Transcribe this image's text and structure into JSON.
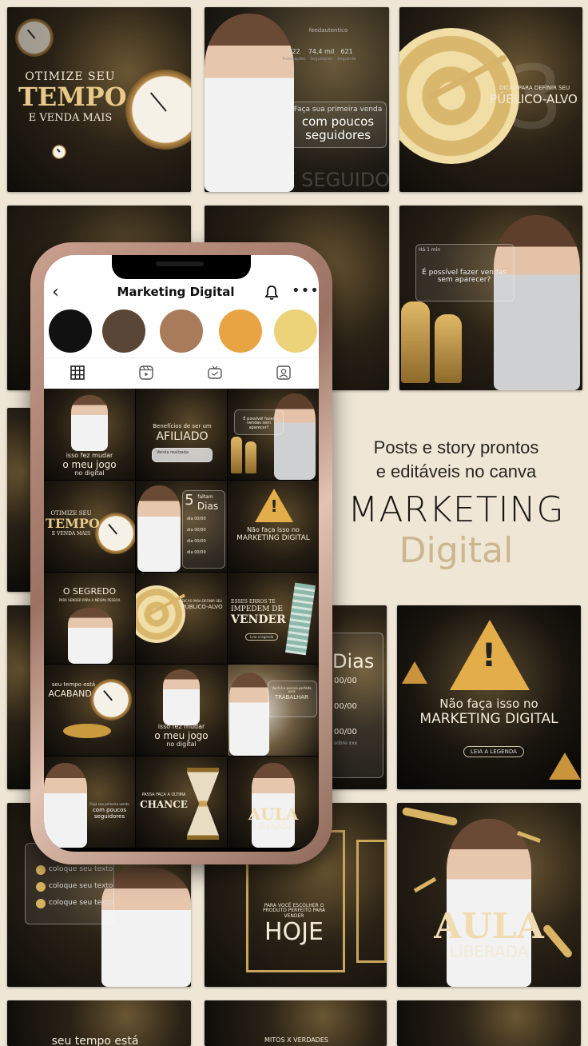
{
  "app": {
    "profile_title": "Marketing Digital",
    "back_icon": "chevron-left-icon",
    "bell_icon": "bell-icon",
    "more_icon": "more-horizontal-icon"
  },
  "palette": [
    "#111111",
    "#5a4636",
    "#a87b5a",
    "#e8a443",
    "#ecd279"
  ],
  "tabs": [
    "grid-icon",
    "reels-icon",
    "tv-icon",
    "tagged-icon"
  ],
  "promo": {
    "line1": "Posts e story prontos",
    "line2": "e editáveis no canva",
    "title_top": "MARKETING",
    "title_bottom": "Digital"
  },
  "tiles": {
    "otimize": {
      "top": "OTIMIZE SEU",
      "big": "TEMPO",
      "bottom": "E VENDA MAIS"
    },
    "seguidores": {
      "handle": "feedautentico",
      "stats": [
        "322",
        "74,4 mil",
        "621"
      ],
      "stat_labels": [
        "Publicações",
        "Seguidores",
        "Seguindo"
      ],
      "line1": "Faça sua primeira venda",
      "line2": "com poucos",
      "line3": "seguidores",
      "bg_text": "K SEGUIDO"
    },
    "publico": {
      "small": "DICAS PARA DEFINIR SEU",
      "big": "PÚBLICO-ALVO",
      "num": "3"
    },
    "vendas": {
      "time": "Há 1 min",
      "q": "É possível fazer vendas sem aparecer?"
    },
    "falta": {
      "big": "Dias",
      "items": [
        "00/00",
        "00/00",
        "00/00"
      ],
      "sub": "sobre xxx"
    },
    "alerta": {
      "line1": "Não faça isso no",
      "line2": "MARKETING DIGITAL",
      "btn": "LEIA A LEGENDA"
    },
    "check": {
      "items": [
        "coloque seu texto",
        "coloque seu texto",
        "coloque seu texto"
      ]
    },
    "hoje": {
      "small": "PARA VOCÊ ESCOLHER O PRODUTO PERFEITO PARA VENDER",
      "big": "HOJE"
    },
    "aula": {
      "big": "AULA",
      "small": "LIBERADA"
    },
    "bottom_a": "seu tempo está",
    "bottom_b": "MITOS X VERDADES"
  },
  "feed": {
    "c1": {
      "a": "isso fez mudar",
      "b": "o meu jogo",
      "c": "no digital"
    },
    "c2": {
      "a": "Benefícios de ser um",
      "b": "AFILIADO",
      "c": "Venda realizada"
    },
    "c3": {
      "a": "É possível fazer vendas sem aparecer?"
    },
    "c4": {
      "a": "OTIMIZE SEU",
      "b": "TEMPO",
      "c": "E VENDA MAIS"
    },
    "c5": {
      "a": "5",
      "b": "faltam",
      "c": "Dias",
      "items": [
        "dia 00/00",
        "dia 00/00",
        "dia 00/00",
        "dia 00/00"
      ]
    },
    "c6": {
      "a": "Não faça isso no",
      "b": "MARKETING DIGITAL"
    },
    "c7": {
      "a": "O SEGREDO",
      "b": "PARA VENDER PARA A MESMA PESSOA"
    },
    "c8": {
      "a": "DICAS PARA DEFINIR SEU",
      "b": "PÚBLICO-ALVO"
    },
    "c9": {
      "a": "ESSES ERROS TE",
      "b": "IMPEDEM DE",
      "c": "VENDER",
      "d": "Leia a legenda"
    },
    "c10": {
      "a": "seu tempo está",
      "b": "ACABANDO"
    },
    "c11": {
      "a": "isso fez mudar",
      "b": "o meu jogo",
      "c": "no digital"
    },
    "c12": {
      "a": "Você é a pessoa perfeita para",
      "b": "TRABALHAR"
    },
    "c13": {
      "a": "Faça sua primeira venda",
      "b": "com poucos",
      "c": "seguidores"
    },
    "c14": {
      "a": "PASSA FAÇA A ÚLTIMA",
      "b": "CHANCE"
    },
    "c15": {
      "a": "AULA",
      "b": "LIBERADA"
    }
  }
}
